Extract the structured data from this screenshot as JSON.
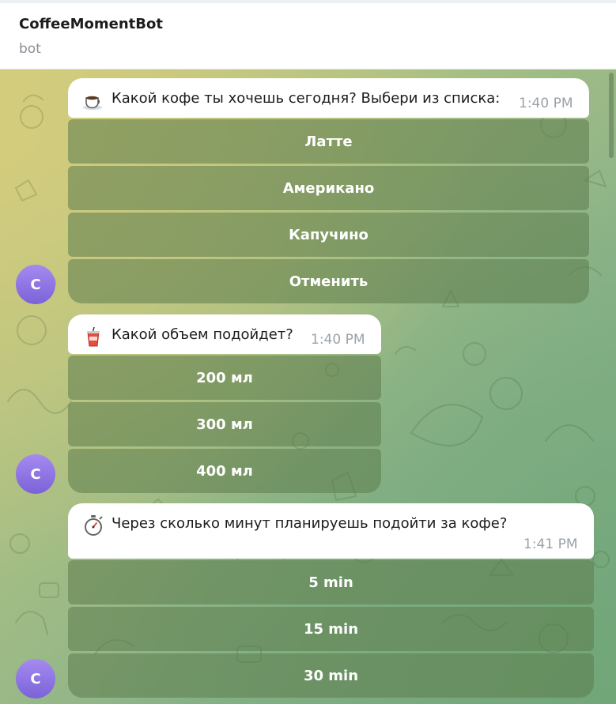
{
  "header": {
    "title": "CoffeeMomentBot",
    "subtitle": "bot"
  },
  "avatar_letter": "C",
  "messages": [
    {
      "emoji": "coffee-cup-icon",
      "text": "Какой кофе ты хочешь сегодня? Выбери из списка:",
      "time": "1:40 PM",
      "buttons": [
        "Латте",
        "Американо",
        "Капучино",
        "Отменить"
      ]
    },
    {
      "emoji": "drink-cup-icon",
      "text": "Какой объем подойдет?",
      "time": "1:40 PM",
      "buttons": [
        "200 мл",
        "300 мл",
        "400 мл"
      ]
    },
    {
      "emoji": "stopwatch-icon",
      "text": "Через сколько минут планируешь подойти за кофе?",
      "time": "1:41 PM",
      "buttons": [
        "5 min",
        "15 min",
        "30 min"
      ]
    }
  ]
}
